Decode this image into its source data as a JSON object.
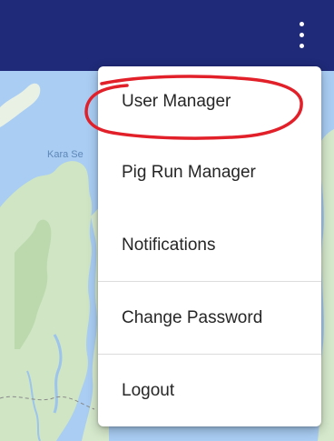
{
  "app_bar": {
    "color": "#1f2a78",
    "more_icon": "more-vert-icon"
  },
  "map": {
    "label": "Kara Se",
    "water_color": "#a9cdf3",
    "land_color": "#cfe5c4"
  },
  "menu": {
    "items": [
      {
        "label": "User Manager"
      },
      {
        "label": "Pig Run Manager"
      },
      {
        "label": "Notifications"
      },
      {
        "label": "Change Password"
      },
      {
        "label": "Logout"
      }
    ]
  },
  "annotation": {
    "color": "#e1202a",
    "target": "User Manager"
  }
}
